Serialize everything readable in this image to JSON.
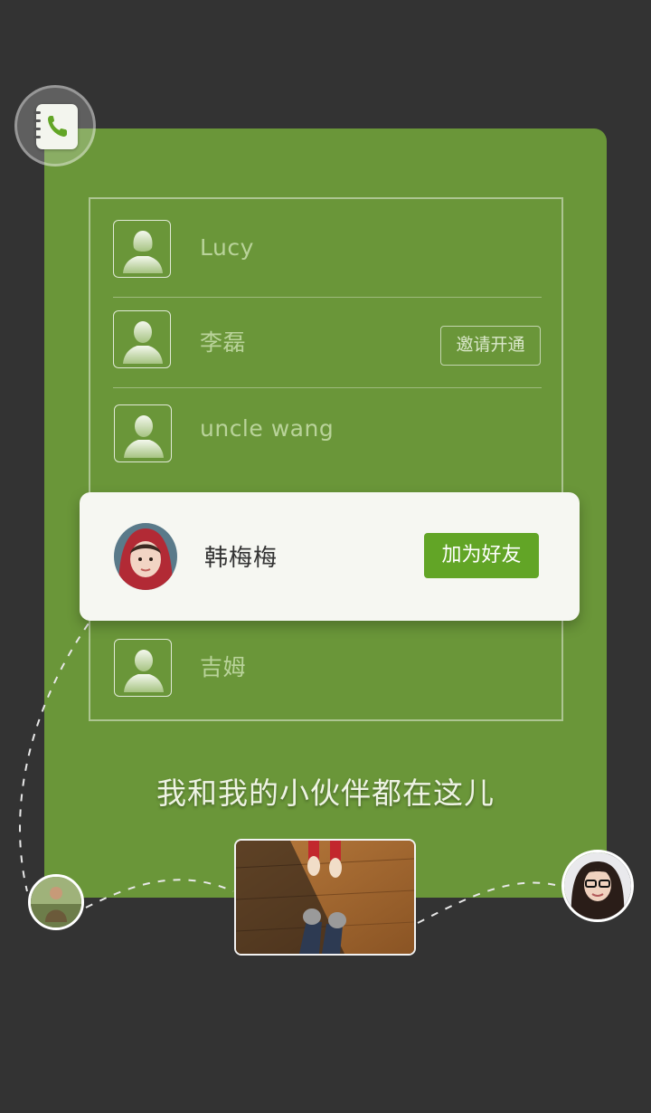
{
  "contacts": [
    {
      "name": "Lucy",
      "avatar": "female-silhouette-icon"
    },
    {
      "name": "李磊",
      "avatar": "male-silhouette-icon",
      "action_label": "邀请开通"
    },
    {
      "name": "uncle wang",
      "avatar": "male-silhouette-icon"
    },
    {
      "name": "吉姆",
      "avatar": "male-silhouette-icon"
    }
  ],
  "popup": {
    "name": "韩梅梅",
    "action_label": "加为好友"
  },
  "tagline": "我和我的小伙伴都在这儿",
  "colors": {
    "background": "#333333",
    "card": "#6a9639",
    "accent_button": "#62a526",
    "popup": "#f6f7f2"
  },
  "icons": {
    "badge": "phone-book-icon"
  }
}
